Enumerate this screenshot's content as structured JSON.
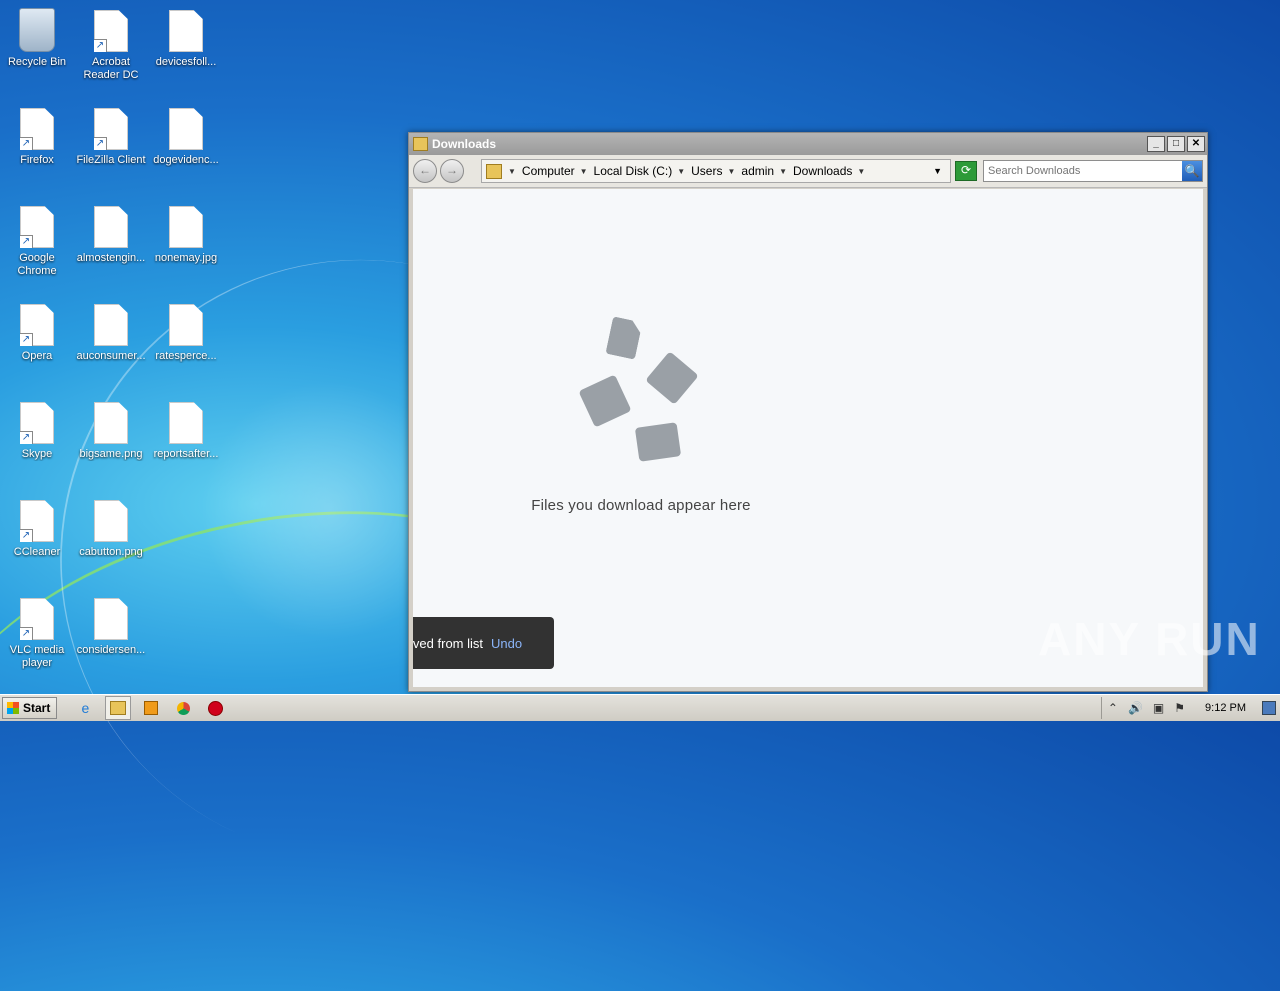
{
  "desktop": {
    "icons": [
      {
        "label": "Recycle Bin",
        "type": "bin"
      },
      {
        "label": "Acrobat Reader DC",
        "type": "shortcut"
      },
      {
        "label": "devicesfoll...",
        "type": "file"
      },
      {
        "label": "Firefox",
        "type": "shortcut"
      },
      {
        "label": "FileZilla Client",
        "type": "shortcut"
      },
      {
        "label": "dogevidenc...",
        "type": "file"
      },
      {
        "label": "Google Chrome",
        "type": "shortcut"
      },
      {
        "label": "almostengin...",
        "type": "file"
      },
      {
        "label": "nonemay.jpg",
        "type": "file"
      },
      {
        "label": "Opera",
        "type": "shortcut"
      },
      {
        "label": "auconsumer...",
        "type": "file"
      },
      {
        "label": "ratesperce...",
        "type": "file"
      },
      {
        "label": "Skype",
        "type": "shortcut"
      },
      {
        "label": "bigsame.png",
        "type": "file"
      },
      {
        "label": "reportsafter...",
        "type": "file"
      },
      {
        "label": "CCleaner",
        "type": "shortcut"
      },
      {
        "label": "cabutton.png",
        "type": "file"
      },
      {
        "label": "VLC media player",
        "type": "shortcut"
      },
      {
        "label": "considersen...",
        "type": "file"
      }
    ]
  },
  "window": {
    "title": "Downloads",
    "buttons": {
      "minimize": "_",
      "maximize": "□",
      "close": "✕"
    },
    "nav": {
      "back": "←",
      "forward": "→"
    },
    "breadcrumbs": [
      "Computer",
      "Local Disk (C:)",
      "Users",
      "admin",
      "Downloads"
    ],
    "search_placeholder": "Search Downloads",
    "refresh_icon": "⟳",
    "search_icon": "🔍"
  },
  "content": {
    "empty_message": "Files you download appear here",
    "toast": {
      "message": "Removed from list",
      "action": "Undo"
    }
  },
  "watermark": "ANY RUN",
  "taskbar": {
    "start_label": "Start",
    "pinned": [
      "ie-icon",
      "explorer-icon",
      "media-player-icon",
      "chrome-icon",
      "opera-icon"
    ],
    "clock": "9:12 PM"
  }
}
